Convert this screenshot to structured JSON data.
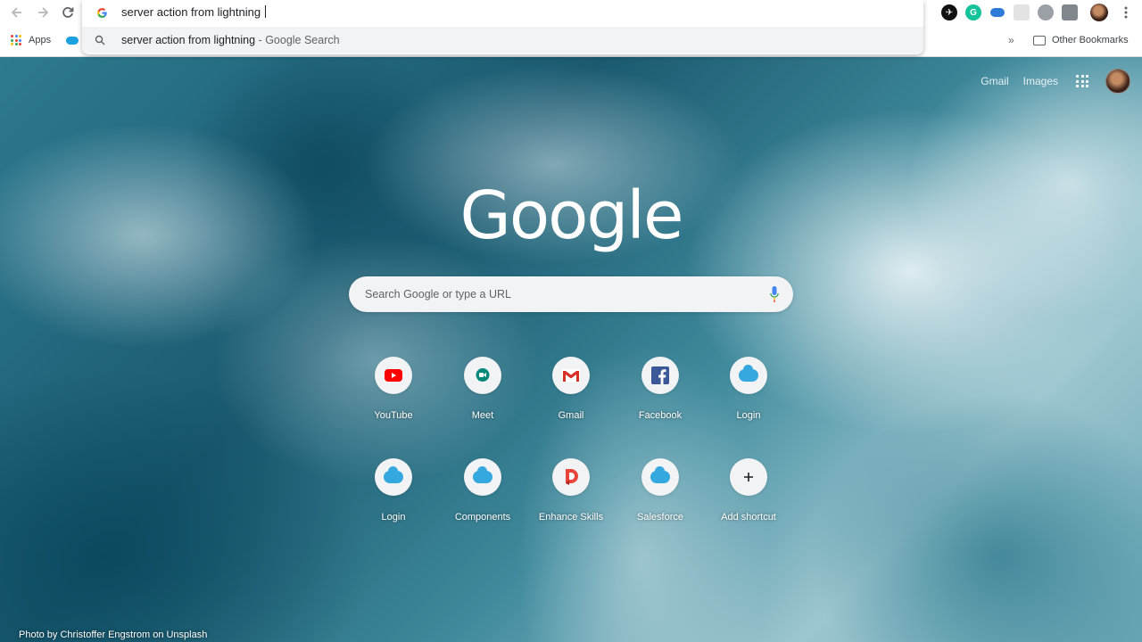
{
  "omnibox": {
    "typed_text": "server action from lightning ",
    "suggestion_query": "server action from lightning",
    "suggestion_separator": " - ",
    "suggestion_source": "Google Search"
  },
  "bookmarks": {
    "apps_label": "Apps",
    "more_label": "»",
    "other_label": "Other Bookmarks"
  },
  "ntp": {
    "top_links": {
      "gmail": "Gmail",
      "images": "Images"
    },
    "logo_text": "Google",
    "search_placeholder": "Search Google or type a URL",
    "shortcuts": [
      {
        "label": "YouTube",
        "icon": "youtube-icon"
      },
      {
        "label": "Meet",
        "icon": "meet-icon"
      },
      {
        "label": "Gmail",
        "icon": "gmail-icon"
      },
      {
        "label": "Facebook",
        "icon": "facebook-icon"
      },
      {
        "label": "Login",
        "icon": "salesforce-cloud-icon"
      },
      {
        "label": "Login",
        "icon": "salesforce-cloud-icon"
      },
      {
        "label": "Components",
        "icon": "salesforce-cloud-icon"
      },
      {
        "label": "Enhance Skills",
        "icon": "enhance-skills-icon"
      },
      {
        "label": "Salesforce",
        "icon": "salesforce-cloud-icon"
      },
      {
        "label": "Add shortcut",
        "icon": "plus-icon"
      }
    ],
    "photo_credit": "Photo by Christoffer Engstrom on Unsplash"
  },
  "colors": {
    "youtube": "#ff0000",
    "meet": "#00897b",
    "gmail": "#d93025",
    "facebook": "#3b5998",
    "salesforce": "#35a8e0",
    "google_blue": "#4285f4"
  }
}
